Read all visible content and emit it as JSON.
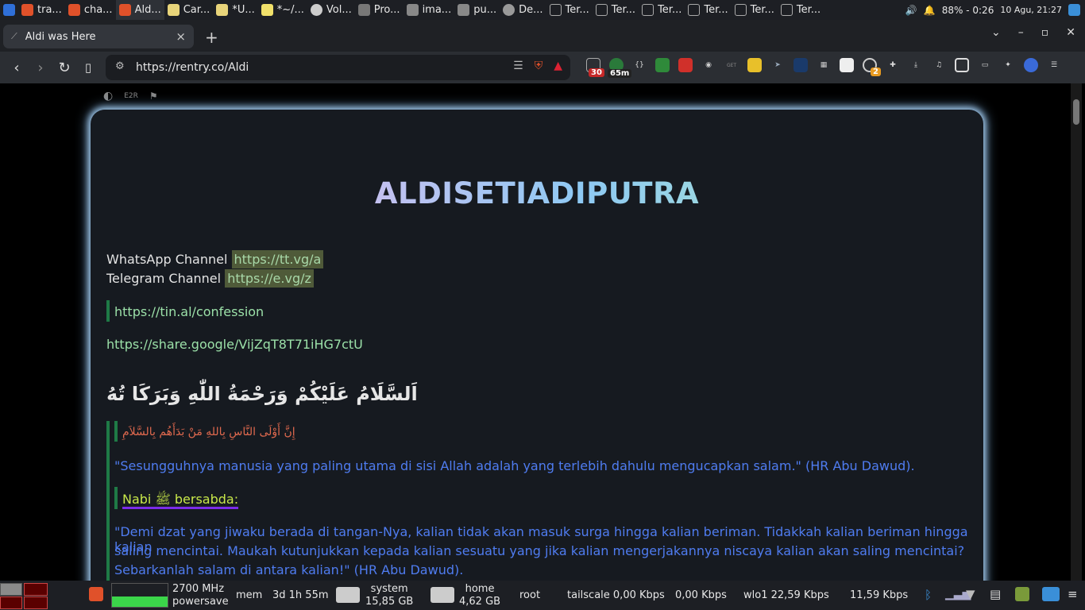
{
  "os_taskbar": {
    "tasks": [
      "tra...",
      "cha...",
      "Ald...",
      "Car...",
      "*U...",
      "*~/...",
      "Vol...",
      "Pro...",
      "ima...",
      "pu...",
      "De...",
      "Ter...",
      "Ter...",
      "Ter...",
      "Ter...",
      "Ter...",
      "Ter..."
    ],
    "battery": "88% - 0:26",
    "datetime": "10 Agu, 21:27"
  },
  "browser": {
    "tab_title": "Aldi was Here",
    "tab_close": "×",
    "new_tab": "+",
    "url": "https://rentry.co/Aldi",
    "extension_badges": {
      "count": "30",
      "timer": "65m",
      "notif": "2"
    }
  },
  "page": {
    "tools_label": "E2R",
    "title": "ALDISETIADIPUTRA",
    "whatsapp_label": "WhatsApp Channel",
    "whatsapp_link": "https://tt.vg/a",
    "telegram_label": "Telegram Channel",
    "telegram_link": "https://e.vg/z",
    "confession_link": "https://tin.al/confession",
    "share_link": "https://share.google/VijZqT8T71iHG7ctU",
    "salam": "اَلسَّلَامُ عَلَيْكُمْ وَرَحْمَةُ اللّٰهِ وَبَرَكَا تُهُ",
    "hadith_arabic": "إِنَّ أَوْلَى النَّاسِ بِاللهِ مَنْ بَدَأَهُم بِالسَّلاَمِ",
    "hadith1": "\"Sesungguhnya manusia yang paling utama di sisi Allah adalah yang terlebih dahulu mengucapkan salam.\" (HR Abu Dawud).",
    "nabi_label": "Nabi ﷺ bersabda:",
    "hadith2_line1": "\"Demi dzat yang jiwaku berada di tangan-Nya, kalian tidak akan masuk surga hingga kalian beriman. Tidakkah kalian beriman hingga kalian",
    "hadith2_line2": "saling mencintai. Maukah kutunjukkan kepada kalian sesuatu yang jika kalian mengerjakannya niscaya kalian akan saling mencintai?",
    "hadith2_line3": "Sebarkanlah salam di antara kalian!\" (HR Abu Dawud)."
  },
  "panel": {
    "cpu_freq": "2700 MHz",
    "cpu_gov": "powersave",
    "mem_label": "mem",
    "uptime": "3d 1h 55m",
    "system_label": "system",
    "system_size": "15,85 GB",
    "home_label": "home",
    "home_size": "4,62 GB",
    "root_label": "root",
    "tailscale": "tailscale 0,00 Kbps",
    "tailscale_up": "0,00 Kbps",
    "wlo1": "wlo1  22,59 Kbps",
    "wlo1_up": "11,59 Kbps"
  },
  "colors": {
    "card_glow": "#9fc6e8",
    "quote_bar": "#1f7a46",
    "link_green": "#9be0a8",
    "hadith_blue": "#4f7cf0"
  }
}
